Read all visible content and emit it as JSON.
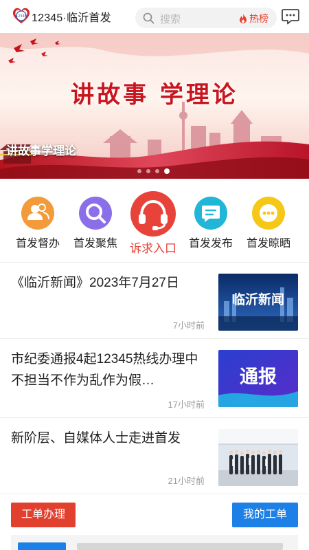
{
  "header": {
    "app_title": "12345·临沂首发",
    "logo_text": "12345",
    "search_placeholder": "搜索",
    "hot_label": "热榜"
  },
  "banner": {
    "headline": "讲故事 学理论",
    "caption": "讲故事学理论",
    "slide_count": 4,
    "active_slide": 4
  },
  "menu": [
    {
      "label": "首发督办",
      "icon": "people-icon",
      "color": "#f39a3a"
    },
    {
      "label": "首发聚焦",
      "icon": "magnifier-icon",
      "color": "#8b6fe8"
    },
    {
      "label": "诉求入口",
      "icon": "headset-icon",
      "color": "#e8433b"
    },
    {
      "label": "首发发布",
      "icon": "chat-icon",
      "color": "#21b5d8"
    },
    {
      "label": "首发晾晒",
      "icon": "ellipsis-icon",
      "color": "#f5c716"
    }
  ],
  "news": [
    {
      "title": "《临沂新闻》2023年7月27日",
      "time": "7小时前",
      "thumb_text": "临沂新闻"
    },
    {
      "title": "市纪委通报4起12345热线办理中不担当不作为乱作为假…",
      "time": "17小时前",
      "thumb_text": "通报"
    },
    {
      "title": "新阶层、自媒体人士走进首发",
      "time": "21小时前",
      "thumb_text": ""
    }
  ],
  "actions": {
    "work_order": "工单办理",
    "my_orders": "我的工单"
  },
  "colors": {
    "accent_red": "#e2402f",
    "accent_blue": "#1d80e6"
  }
}
